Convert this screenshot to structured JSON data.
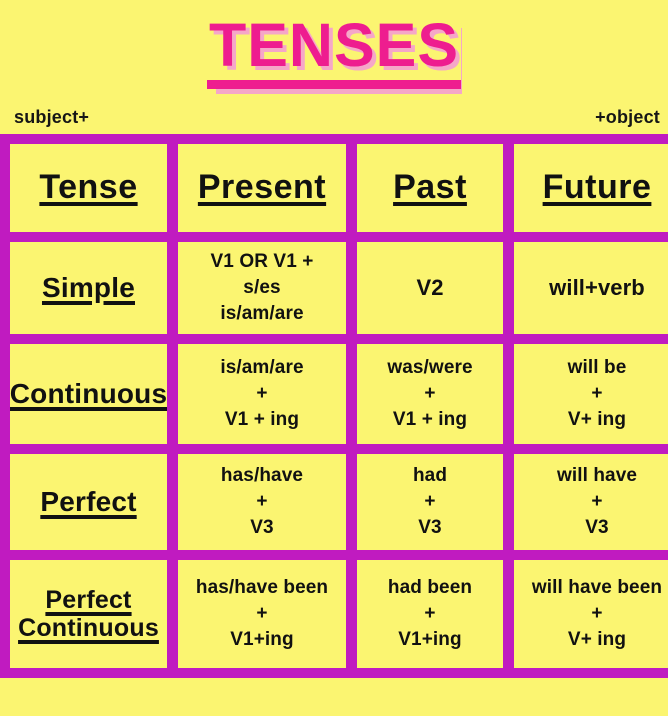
{
  "title": "TENSES",
  "labels": {
    "left": "subject+",
    "right": "+object"
  },
  "colors": {
    "background": "#FBF571",
    "cell": "#FBF571",
    "grid": "#C01BC0",
    "title": "#EE1D8F",
    "title_shadow": "#F5A7C8",
    "text": "#111111"
  },
  "table": {
    "headers": [
      "Tense",
      "Present",
      "Past",
      "Future"
    ],
    "rows": [
      {
        "label": "Simple",
        "present": [
          "V1 OR V1 +",
          "s/es",
          "is/am/are"
        ],
        "past": [
          "V2"
        ],
        "future": [
          "will+verb"
        ]
      },
      {
        "label": "Continuous",
        "present": [
          "is/am/are",
          "+",
          "V1 + ing"
        ],
        "past": [
          "was/were",
          "+",
          "V1 + ing"
        ],
        "future": [
          "will be",
          "+",
          "V+ ing"
        ]
      },
      {
        "label": "Perfect",
        "present": [
          "has/have",
          "+",
          "V3"
        ],
        "past": [
          "had",
          "+",
          "V3"
        ],
        "future": [
          "will have",
          "+",
          "V3"
        ]
      },
      {
        "label": "Perfect Continuous",
        "label_lines": [
          "Perfect",
          "Continuous"
        ],
        "present": [
          "has/have been",
          "+",
          "V1+ing"
        ],
        "past": [
          "had been",
          "+",
          "V1+ing"
        ],
        "future": [
          "will have been",
          "+",
          "V+ ing"
        ]
      }
    ]
  }
}
